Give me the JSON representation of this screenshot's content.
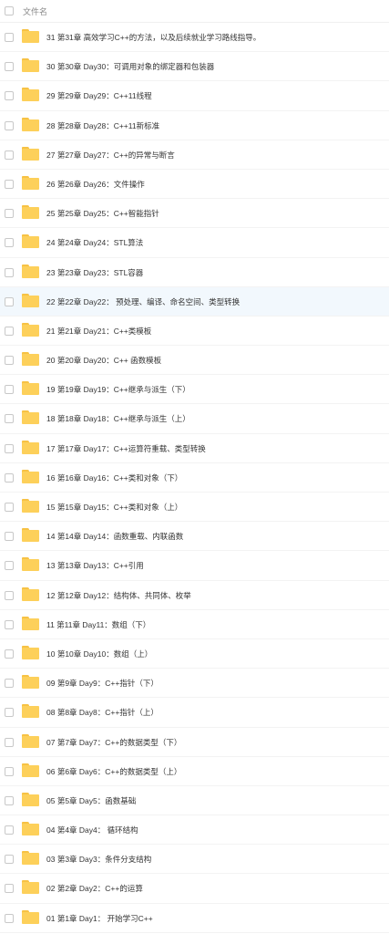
{
  "header": {
    "label": "文件名"
  },
  "rows": [
    {
      "name": "31 第31章 高效学习C++的方法，以及后续就业学习路线指导。"
    },
    {
      "name": "30 第30章 Day30：可调用对象的绑定器和包装器"
    },
    {
      "name": "29 第29章 Day29：C++11线程"
    },
    {
      "name": "28 第28章 Day28：C++11新标准"
    },
    {
      "name": "27 第27章 Day27：C++的异常与断言"
    },
    {
      "name": "26 第26章 Day26：文件操作"
    },
    {
      "name": "25 第25章 Day25：C++智能指针"
    },
    {
      "name": "24 第24章 Day24：STL算法"
    },
    {
      "name": "23 第23章 Day23：STL容器"
    },
    {
      "name": "22 第22章 Day22：  预处理、编译、命名空间、类型转换",
      "highlight": true
    },
    {
      "name": "21 第21章 Day21：C++类模板"
    },
    {
      "name": "20 第20章 Day20：C++ 函数模板"
    },
    {
      "name": "19 第19章 Day19：C++继承与派生（下）"
    },
    {
      "name": "18 第18章 Day18：C++继承与派生（上）"
    },
    {
      "name": "17 第17章 Day17：C++运算符重载、类型转换"
    },
    {
      "name": "16 第16章 Day16：C++类和对象（下）"
    },
    {
      "name": "15 第15章 Day15：C++类和对象（上）"
    },
    {
      "name": "14 第14章 Day14：函数重载、内联函数"
    },
    {
      "name": "13 第13章 Day13：C++引用"
    },
    {
      "name": "12 第12章 Day12：结构体、共同体、枚举"
    },
    {
      "name": "11 第11章 Day11：数组（下）"
    },
    {
      "name": "10 第10章 Day10：数组（上）"
    },
    {
      "name": "09 第9章 Day9：C++指针（下）"
    },
    {
      "name": "08 第8章 Day8：C++指针（上）"
    },
    {
      "name": "07 第7章 Day7：C++的数据类型（下）"
    },
    {
      "name": "06 第6章 Day6：C++的数据类型（上）"
    },
    {
      "name": "05 第5章 Day5：函数基础"
    },
    {
      "name": "04 第4章 Day4：  循环结构"
    },
    {
      "name": "03 第3章 Day3：条件分支结构"
    },
    {
      "name": "02 第2章 Day2：C++的运算"
    },
    {
      "name": "01 第1章 Day1：  开始学习C++"
    }
  ]
}
